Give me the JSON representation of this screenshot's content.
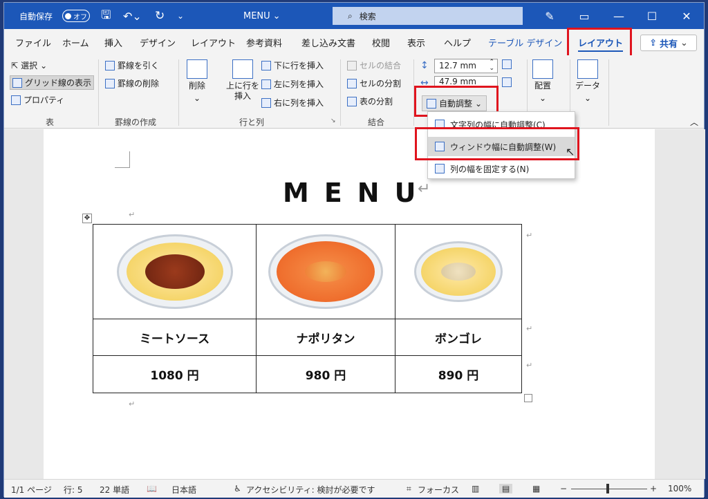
{
  "titlebar": {
    "autosave_label": "自動保存",
    "autosave_state": "オフ",
    "doc_title": "MENU",
    "search_placeholder": "検索"
  },
  "tabs": [
    "ファイル",
    "ホーム",
    "挿入",
    "デザイン",
    "レイアウト",
    "参考資料",
    "差し込み文書",
    "校閲",
    "表示",
    "ヘルプ",
    "テーブル デザイン",
    "レイアウト"
  ],
  "share_label": "共有",
  "ribbon": {
    "table_group": {
      "select": "選択",
      "gridlines": "グリッド線の表示",
      "properties": "プロパティ",
      "label": "表"
    },
    "draw_group": {
      "draw": "罫線を引く",
      "erase": "罫線の削除",
      "label": "罫線の作成"
    },
    "rowscols_group": {
      "delete": "削除",
      "insert_above": "上に行を挿入",
      "insert_below": "下に行を挿入",
      "insert_left": "左に列を挿入",
      "insert_right": "右に列を挿入",
      "label": "行と列"
    },
    "merge_group": {
      "merge": "セルの結合",
      "split_cells": "セルの分割",
      "split_table": "表の分割",
      "label": "結合"
    },
    "size_group": {
      "height": "12.7 mm",
      "width": "47.9 mm",
      "autofit": "自動調整"
    },
    "align_label": "配置",
    "data_label": "データ"
  },
  "dropdown": {
    "items": [
      "文字列の幅に自動調整(C)",
      "ウィンドウ幅に自動調整(W)",
      "列の幅を固定する(N)"
    ]
  },
  "document": {
    "title": "MENU",
    "dishes": [
      {
        "name": "ミートソース",
        "price": "1080 円"
      },
      {
        "name": "ナポリタン",
        "price": "980 円"
      },
      {
        "name": "ボンゴレ",
        "price": "890 円"
      }
    ]
  },
  "status": {
    "page": "1/1 ページ",
    "line": "行: 5",
    "words": "22 単語",
    "language": "日本語",
    "accessibility": "アクセシビリティ: 検討が必要です",
    "focus": "フォーカス",
    "zoom": "100%"
  },
  "colors": {
    "titlebar": "#1c57b8",
    "highlight": "#e0141e"
  }
}
